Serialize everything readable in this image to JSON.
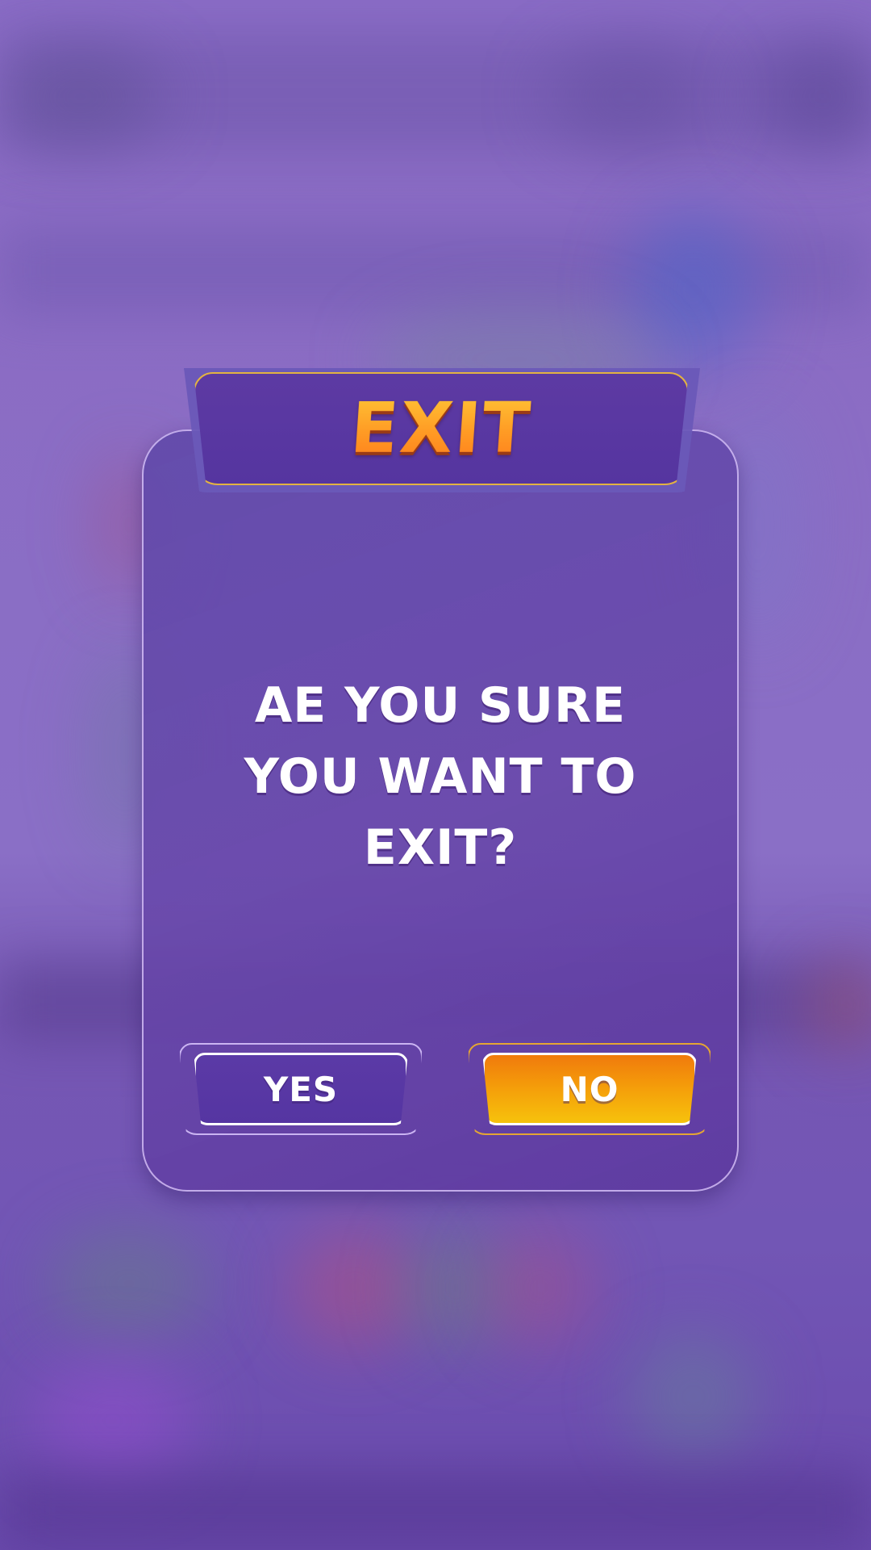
{
  "dialog": {
    "title": "EXIT",
    "message_lines": [
      "AE YOU SURE",
      "YOU WANT TO",
      "EXIT?"
    ],
    "buttons": {
      "yes_label": "YES",
      "no_label": "NO"
    }
  },
  "colors": {
    "panel": "#5f45a6",
    "title_gradient_top": "#ffc837",
    "title_gradient_bottom": "#ff7a1b",
    "no_button": "#f59f0a",
    "yes_button": "#5535a2",
    "accent_border": "#e3b341"
  }
}
